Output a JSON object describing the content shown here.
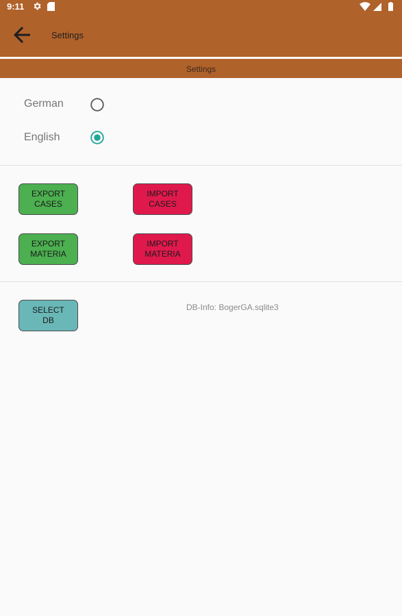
{
  "status_bar": {
    "time": "9:11",
    "icons": [
      "gear-icon",
      "sd-card-icon",
      "wifi-icon",
      "signal-icon",
      "battery-icon"
    ]
  },
  "app_bar": {
    "title": "Settings",
    "back_icon": "arrow-back-icon",
    "color": "#b0622b"
  },
  "section_header": {
    "label": "Settings"
  },
  "language": {
    "options": [
      {
        "label": "German",
        "selected": false
      },
      {
        "label": "English",
        "selected": true
      }
    ],
    "accent_color": "#26a69a"
  },
  "buttons": {
    "export_cases": "EXPORT\nCASES",
    "import_cases": "IMPORT\nCASES",
    "export_materia": "EXPORT\nMATERIA",
    "import_materia": "IMPORT\nMATERIA",
    "select_db": "SELECT\nDB"
  },
  "db_info": "DB-Info: BogerGA.sqlite3",
  "colors": {
    "export": "#4caf50",
    "import": "#e0194d",
    "select_db": "#6ab7b7"
  }
}
